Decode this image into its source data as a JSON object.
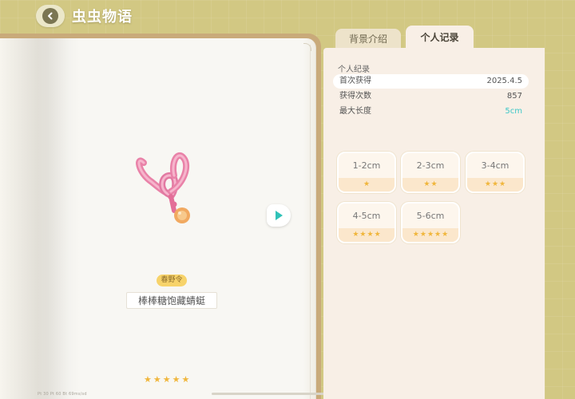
{
  "header": {
    "title": "虫虫物语"
  },
  "tabs": [
    {
      "label": "背景介绍"
    },
    {
      "label": "个人记录"
    }
  ],
  "insect": {
    "tag": "春野令",
    "name": "棒棒糖饱藏蜻蜓",
    "rarity_stars": 5
  },
  "record": {
    "title": "个人纪录",
    "rows": [
      {
        "label": "首次获得",
        "value": "2025.4.5"
      },
      {
        "label": "获得次数",
        "value": "857"
      },
      {
        "label": "最大长度",
        "value": "5cm"
      }
    ]
  },
  "size_tiers": [
    {
      "range": "1-2cm",
      "stars": 1
    },
    {
      "range": "2-3cm",
      "stars": 2
    },
    {
      "range": "3-4cm",
      "stars": 3
    },
    {
      "range": "4-5cm",
      "stars": 4
    },
    {
      "range": "5-6cm",
      "stars": 5
    }
  ],
  "footer": {
    "text": "Pt 30   Pt 60   Bt 69ms/sd"
  },
  "colors": {
    "background": "#d2c883",
    "panel": "#f8efe6",
    "star": "#f0b63c",
    "accent_teal": "#3cc7c7",
    "tag": "#f7d36a"
  }
}
